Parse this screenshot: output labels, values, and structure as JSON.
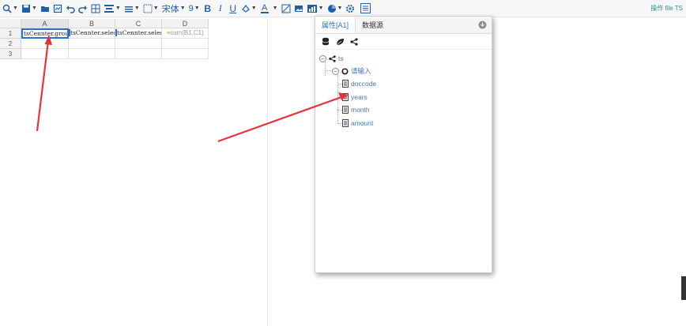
{
  "toolbar": {
    "font_name": "宋体",
    "font_size": "9",
    "bold": "B",
    "italic": "I",
    "underline": "U",
    "font_color": "A",
    "right_link": "操作 file TS",
    "icons": [
      "zoom-icon",
      "save-icon",
      "open-folder-icon",
      "export-icon",
      "undo-icon",
      "redo-icon",
      "merge-cells-icon",
      "align-icon",
      "line-spacing-icon",
      "border-icon",
      "font-select",
      "font-size-select",
      "bold-icon",
      "italic-icon",
      "underline-icon",
      "fill-color-icon",
      "font-color-icon",
      "image-icon",
      "picture-icon",
      "chart-icon",
      "pie-chart-icon",
      "settings-icon",
      "sidebar-toggle-icon"
    ]
  },
  "sheet": {
    "columns": [
      "A",
      "B",
      "C",
      "D"
    ],
    "selected_column": "A",
    "rows": [
      {
        "label": "1",
        "cells": [
          "tsCennter.group",
          "tsCennter.selec",
          "tsCennter.selec",
          "sum(B1,C1)"
        ]
      },
      {
        "label": "2",
        "cells": [
          "",
          "",
          "",
          ""
        ]
      },
      {
        "label": "3",
        "cells": [
          "",
          "",
          "",
          ""
        ]
      }
    ],
    "formula_tag": "≡"
  },
  "panel": {
    "tabs": [
      {
        "label": "属性[A1]",
        "active": true
      },
      {
        "label": "数据源",
        "active": false
      }
    ],
    "tools": [
      "database-icon",
      "leaf-icon",
      "share-icon"
    ],
    "tree": {
      "root": {
        "label": "ts",
        "toggle": "−"
      },
      "group": {
        "label": "请输入",
        "toggle": "−"
      },
      "fields": [
        "doccode",
        "years",
        "month",
        "amount"
      ]
    }
  },
  "colors": {
    "accent": "#2d6fd0",
    "arrow": "#e8333a",
    "toolbar_icon": "#1f5fa8"
  }
}
